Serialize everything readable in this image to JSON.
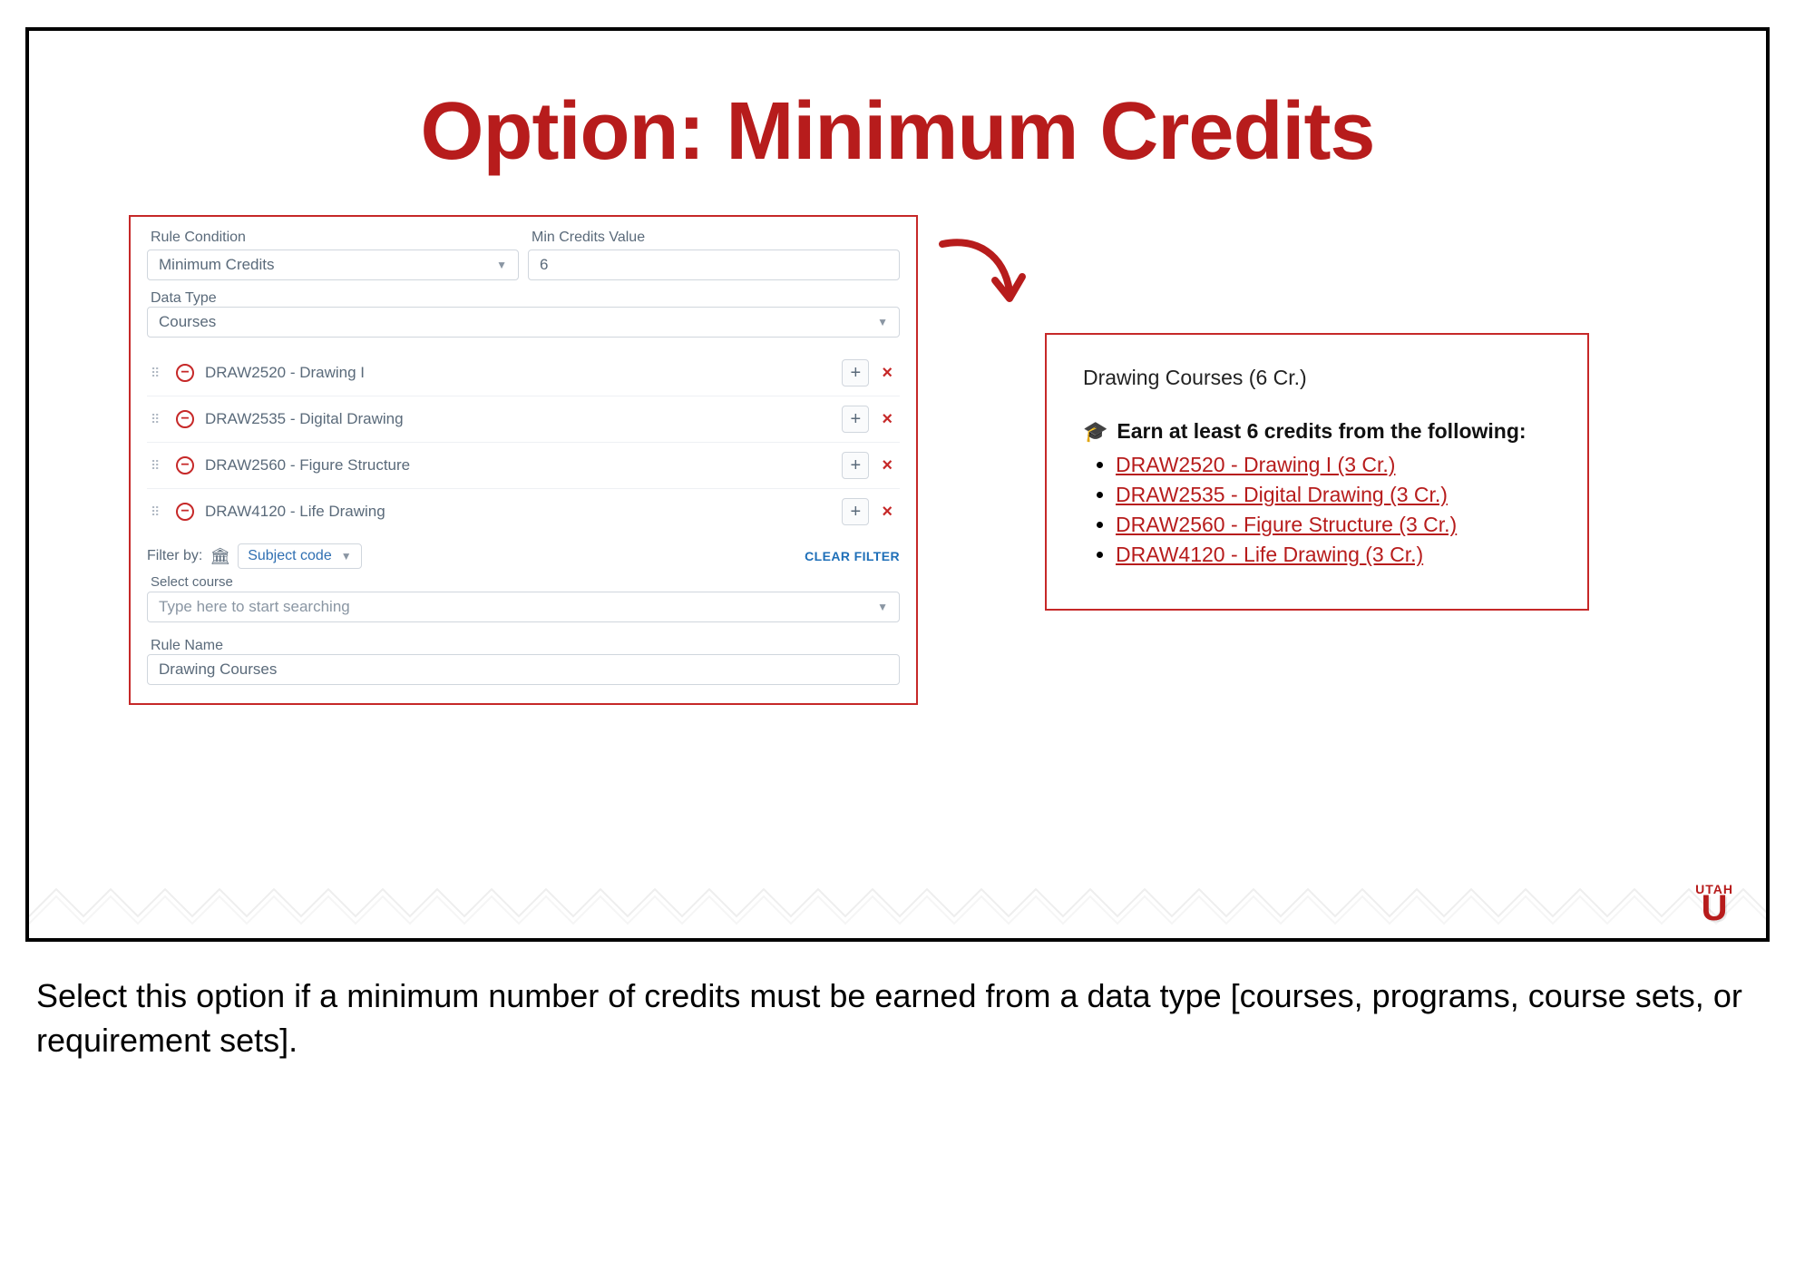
{
  "slide": {
    "title": "Option: Minimum Credits"
  },
  "form": {
    "rule_condition_label": "Rule Condition",
    "rule_condition_value": "Minimum Credits",
    "min_credits_label": "Min Credits Value",
    "min_credits_value": "6",
    "data_type_label": "Data Type",
    "data_type_value": "Courses",
    "courses": [
      {
        "text": "DRAW2520 - Drawing I"
      },
      {
        "text": "DRAW2535 - Digital Drawing"
      },
      {
        "text": "DRAW2560 - Figure Structure"
      },
      {
        "text": "DRAW4120 - Life Drawing"
      }
    ],
    "filter_by_label": "Filter by:",
    "filter_type": "Subject code",
    "clear_filter": "CLEAR FILTER",
    "select_course_label": "Select course",
    "search_placeholder": "Type here to start searching",
    "rule_name_label": "Rule Name",
    "rule_name_value": "Drawing Courses"
  },
  "preview": {
    "title": "Drawing Courses (6 Cr.)",
    "heading": "Earn at least 6 credits from the following:",
    "items": [
      "DRAW2520 - Drawing I (3 Cr.)",
      "DRAW2535 - Digital Drawing (3 Cr.)",
      "DRAW2560 - Figure Structure (3 Cr.)",
      "DRAW4120 - Life Drawing (3 Cr.)"
    ]
  },
  "logo": {
    "top": "UTAH",
    "u": "U"
  },
  "caption": "Select this option if a minimum number of credits must be earned from a data type [courses, programs, course sets, or requirement sets]."
}
